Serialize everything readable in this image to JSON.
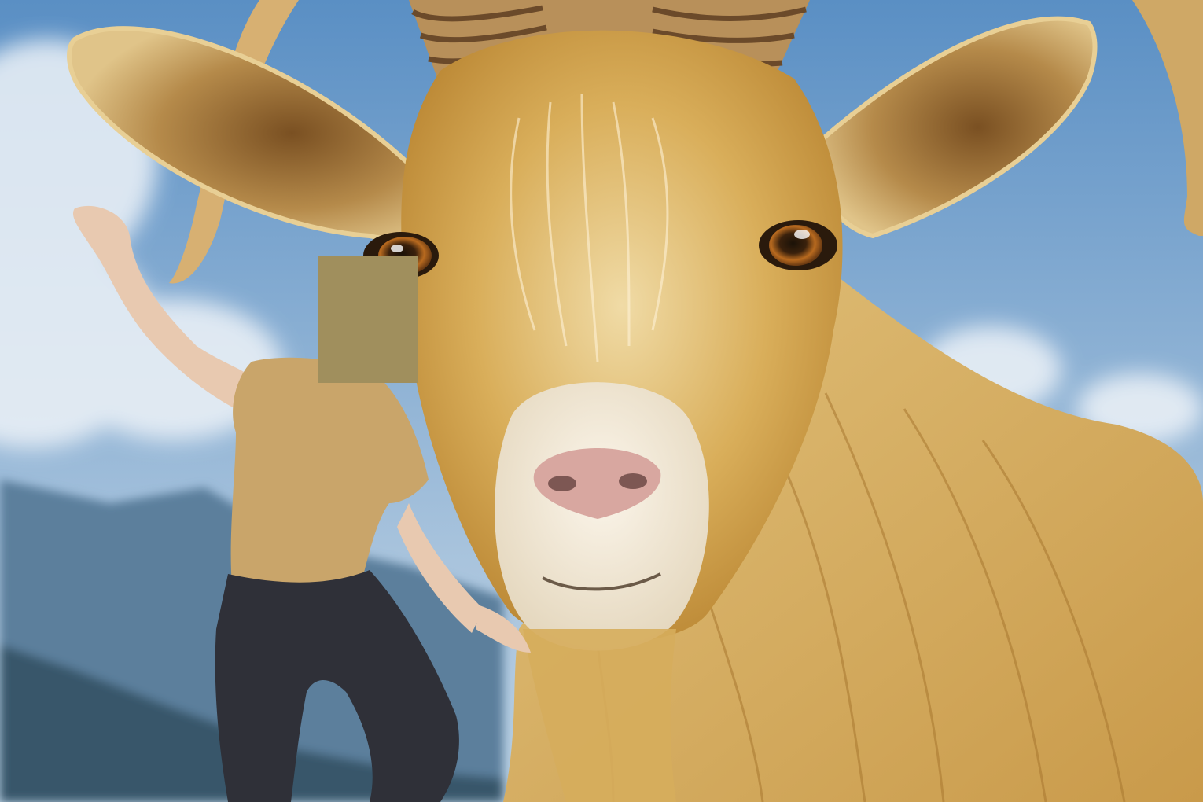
{
  "image": {
    "subject": "golden-goat-and-person",
    "colors": {
      "sky_top": "#5a8fc4",
      "sky_bottom": "#b9d0e3",
      "cloud": "#eef3f8",
      "mountain_far": "#5c7f9c",
      "mountain_near": "#37566b",
      "goat_fur_light": "#e6c77f",
      "goat_fur_mid": "#c89a45",
      "goat_fur_dark": "#8a5f24",
      "goat_muzzle": "#efe6d6",
      "goat_nose": "#d8a7a0",
      "goat_eye": "#b86a1f",
      "horn": "#b8905a",
      "horn_ring": "#6b4a2a",
      "shirt": "#c9a56a",
      "pants": "#2f3038",
      "skin": "#e8c9b0",
      "redaction": "#a08f5d"
    },
    "redaction_mark": "redaction-block"
  }
}
